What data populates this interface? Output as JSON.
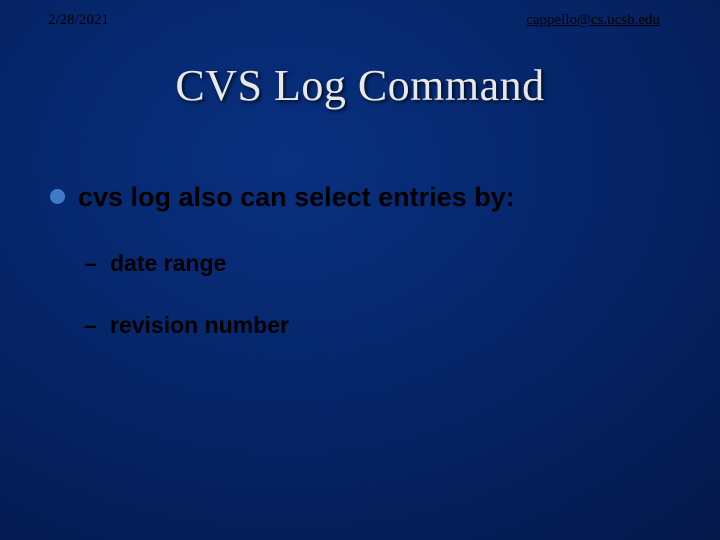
{
  "header": {
    "date": "2/28/2021",
    "email": "cappello@cs.ucsb.edu"
  },
  "title": "CVS Log Command",
  "content": {
    "lead": "cvs log also can select entries by:",
    "items": [
      "date range",
      "revision number"
    ]
  }
}
